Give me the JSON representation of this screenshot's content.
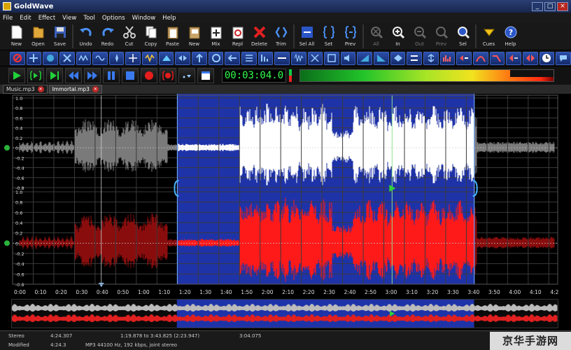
{
  "window": {
    "title": "GoldWave"
  },
  "menu": [
    "File",
    "Edit",
    "Effect",
    "View",
    "Tool",
    "Options",
    "Window",
    "Help"
  ],
  "toolbar": [
    {
      "label": "New",
      "icon": "new-file-icon"
    },
    {
      "label": "Open",
      "icon": "open-folder-icon"
    },
    {
      "label": "Save",
      "icon": "save-disk-icon"
    },
    {
      "label": "Undo",
      "icon": "undo-icon"
    },
    {
      "label": "Redo",
      "icon": "redo-icon"
    },
    {
      "label": "Cut",
      "icon": "scissors-icon"
    },
    {
      "label": "Copy",
      "icon": "copy-icon"
    },
    {
      "label": "Paste",
      "icon": "paste-icon"
    },
    {
      "label": "New",
      "icon": "paste-new-icon"
    },
    {
      "label": "Mix",
      "icon": "mix-icon"
    },
    {
      "label": "Repl",
      "icon": "replace-icon"
    },
    {
      "label": "Delete",
      "icon": "delete-x-icon"
    },
    {
      "label": "Trim",
      "icon": "trim-icon"
    },
    {
      "label": "Sel All",
      "icon": "select-all-icon"
    },
    {
      "label": "Set",
      "icon": "set-selection-icon"
    },
    {
      "label": "Prev",
      "icon": "previous-selection-icon"
    },
    {
      "label": "All",
      "icon": "zoom-all-icon",
      "disabled": true
    },
    {
      "label": "In",
      "icon": "zoom-in-icon"
    },
    {
      "label": "Out",
      "icon": "zoom-out-icon",
      "disabled": true
    },
    {
      "label": "Prev",
      "icon": "zoom-prev-icon",
      "disabled": true
    },
    {
      "label": "Sel",
      "icon": "zoom-selection-icon"
    },
    {
      "label": "Cues",
      "icon": "cues-icon"
    },
    {
      "label": "Help",
      "icon": "help-icon"
    }
  ],
  "transport": {
    "time": "00:03:04.0"
  },
  "tabs": [
    {
      "label": "Music.mp3",
      "active": false
    },
    {
      "label": "Immortal.mp3",
      "active": true
    }
  ],
  "waveform": {
    "y_ticks": [
      "1.0",
      "0.8",
      "0.6",
      "0.4",
      "0.2",
      "0.0",
      "-0.2",
      "-0.4",
      "-0.6",
      "-0.8"
    ],
    "time_ticks": [
      "0:00",
      "0:10",
      "0:20",
      "0:30",
      "0:40",
      "0:50",
      "1:00",
      "1:10",
      "1:20",
      "1:30",
      "1:40",
      "1:50",
      "2:00",
      "2:10",
      "2:20",
      "2:30",
      "2:40",
      "2:50",
      "3:00",
      "3:10",
      "3:20",
      "3:30",
      "3:40",
      "3:50",
      "4:00",
      "4:10",
      "4:2"
    ],
    "duration_s": 264.3,
    "selection_start_s": 79.878,
    "selection_end_s": 223.825,
    "playhead_s": 184.0,
    "colors": {
      "left_channel": "#ffffff",
      "right_channel": "#ff1a1a",
      "selection_bg": "#1f33a8",
      "background": "#000000"
    }
  },
  "status": {
    "row1": [
      "Stereo",
      "4:24.307",
      "1:19.878 to 3:43.825 (2:23.947)",
      "3:04.075"
    ],
    "row2": [
      "Modified",
      "4:24.3",
      "MP3 44100 Hz, 192 kbps, joint stereo"
    ]
  },
  "watermark": "京华手游网"
}
